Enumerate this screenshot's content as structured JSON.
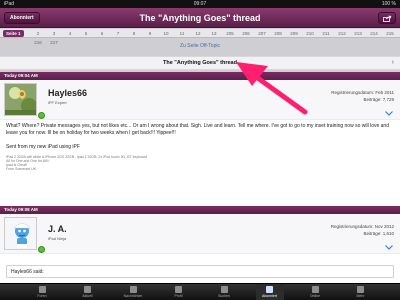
{
  "statusbar": {
    "carrier": "iPad",
    "time": "09:07",
    "battery": "100 %"
  },
  "navbar": {
    "back_label": "Abonniert",
    "title": "The \"Anything Goes\" thread",
    "share_icon": "share-icon"
  },
  "pagination": {
    "current": "Seite 1",
    "pages": [
      "2",
      "3",
      "4",
      "5",
      "6",
      "7",
      "8",
      "9",
      "10",
      "11",
      "12",
      "13",
      "205",
      "206",
      "207",
      "208",
      "209",
      "210",
      "211",
      "212",
      "213",
      "214",
      "215",
      "216",
      "217"
    ]
  },
  "breadcrumb": {
    "link": "Zu Seite Off-Topic"
  },
  "thread": {
    "title": "The \"Anything Goes\" thread"
  },
  "posts": [
    {
      "date": "Today 09:04 AM",
      "username": "Hayles66",
      "rank": "iPF Expert",
      "reg_label": "Registrierungsdatum: Feb 2011",
      "posts_label": "Beiträge: 7,729",
      "body": "What?  Where?  Private messages yes, but not likes etc...  Or am I wrong about that. Sigh. Live and learn. Tell me where. I've got to go to my inset training now so will love and leave you for now. Ill be on holiday for two weeks when I get back!!! Yippee!!!",
      "signature": "Sent from my new iPad using iPF",
      "small_lines": [
        "iPad 2 32GB wifi white & iPhone 3GS 32GB , ipad 1 32GB, 2x iPod touch 3G, BT keyboard",
        "All for One and One for All!!",
        "Ipad is Great!",
        "From Somerset UK"
      ]
    },
    {
      "date": "Today 09:08 AM",
      "username": "J. A.",
      "rank": "iPad Ninja",
      "reg_label": "Registrierungsdatum: Nov 2012",
      "posts_label": "Beiträge: 1,610"
    }
  ],
  "quote": {
    "text": "Hayles66 said:"
  },
  "tabs": [
    {
      "label": "Foren",
      "icon": "forums-icon"
    },
    {
      "label": "Aktuell",
      "icon": "recent-icon"
    },
    {
      "label": "Nachrichten",
      "icon": "messages-icon"
    },
    {
      "label": "Profil",
      "icon": "profile-icon"
    },
    {
      "label": "Suchen",
      "icon": "search-icon"
    },
    {
      "label": "Abonniert",
      "icon": "subscribed-icon",
      "active": true
    },
    {
      "label": "Online",
      "icon": "online-icon"
    },
    {
      "label": "Mehr",
      "icon": "more-icon"
    }
  ],
  "colors": {
    "brand": "#6a2757",
    "annotation_arrow": "#ff1f6e",
    "link": "#4a6aa0",
    "online": "#5cbf3a"
  }
}
